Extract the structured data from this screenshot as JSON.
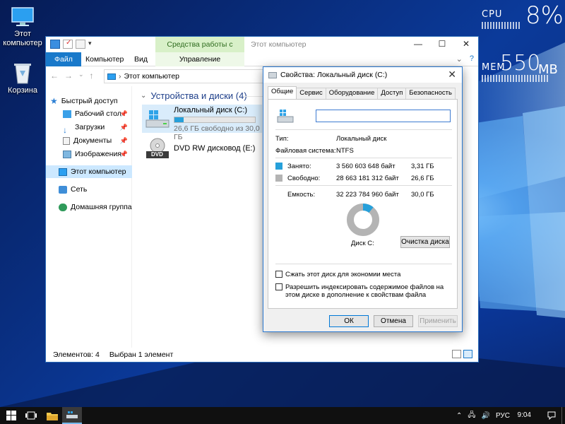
{
  "desktop": {
    "icons": [
      {
        "label": "Этот компьютер",
        "icon": "this-pc-icon"
      },
      {
        "label": "Корзина",
        "icon": "recycle-bin-icon"
      }
    ],
    "cpu": {
      "label": "CPU",
      "value": "8%"
    },
    "mem": {
      "label": "MEM",
      "value": "550",
      "unit": "MB"
    }
  },
  "explorer": {
    "ribbon_context_header": "Средства работы с дисками",
    "title": "Этот компьютер",
    "tabs": {
      "file": "Файл",
      "computer": "Компьютер",
      "view": "Вид",
      "manage": "Управление"
    },
    "address": "Этот компьютер",
    "nav": {
      "quick_access": "Быстрый доступ",
      "desktop": "Рабочий стол",
      "downloads": "Загрузки",
      "documents": "Документы",
      "pictures": "Изображения",
      "this_pc": "Этот компьютер",
      "network": "Сеть",
      "homegroup": "Домашняя группа"
    },
    "group_header": "Устройства и диски (4)",
    "drives": [
      {
        "name": "Локальный диск (C:)",
        "free_text": "26,6 ГБ свободно из 30,0 ГБ",
        "used_fraction": 0.11
      },
      {
        "name": "DVD RW дисковод (E:)",
        "badge": "DVD"
      }
    ],
    "status": {
      "items": "Элементов: 4",
      "selected": "Выбран 1 элемент"
    }
  },
  "dialog": {
    "title": "Свойства: Локальный диск (C:)",
    "tabs": [
      "Общие",
      "Сервис",
      "Оборудование",
      "Доступ",
      "Безопасность"
    ],
    "name_value": "",
    "type_label": "Тип:",
    "type_value": "Локальный диск",
    "fs_label": "Файловая система:",
    "fs_value": "NTFS",
    "used": {
      "label": "Занято:",
      "bytes": "3 560 603 648 байт",
      "size": "3,31 ГБ",
      "color": "#26a0da"
    },
    "free": {
      "label": "Свободно:",
      "bytes": "28 663 181 312 байт",
      "size": "26,6 ГБ",
      "color": "#b4b4b4"
    },
    "capacity": {
      "label": "Емкость:",
      "bytes": "32 223 784 960 байт",
      "size": "30,0 ГБ"
    },
    "disk_label": "Диск C:",
    "cleanup_button": "Очистка диска",
    "compress_label": "Сжать этот диск для экономии места",
    "index_label": "Разрешить индексировать содержимое файлов на этом диске в дополнение к свойствам файла",
    "ok": "ОК",
    "cancel": "Отмена",
    "apply": "Применить",
    "used_fraction": 0.11
  },
  "taskbar": {
    "lang": "РУС",
    "time": "9:04"
  }
}
